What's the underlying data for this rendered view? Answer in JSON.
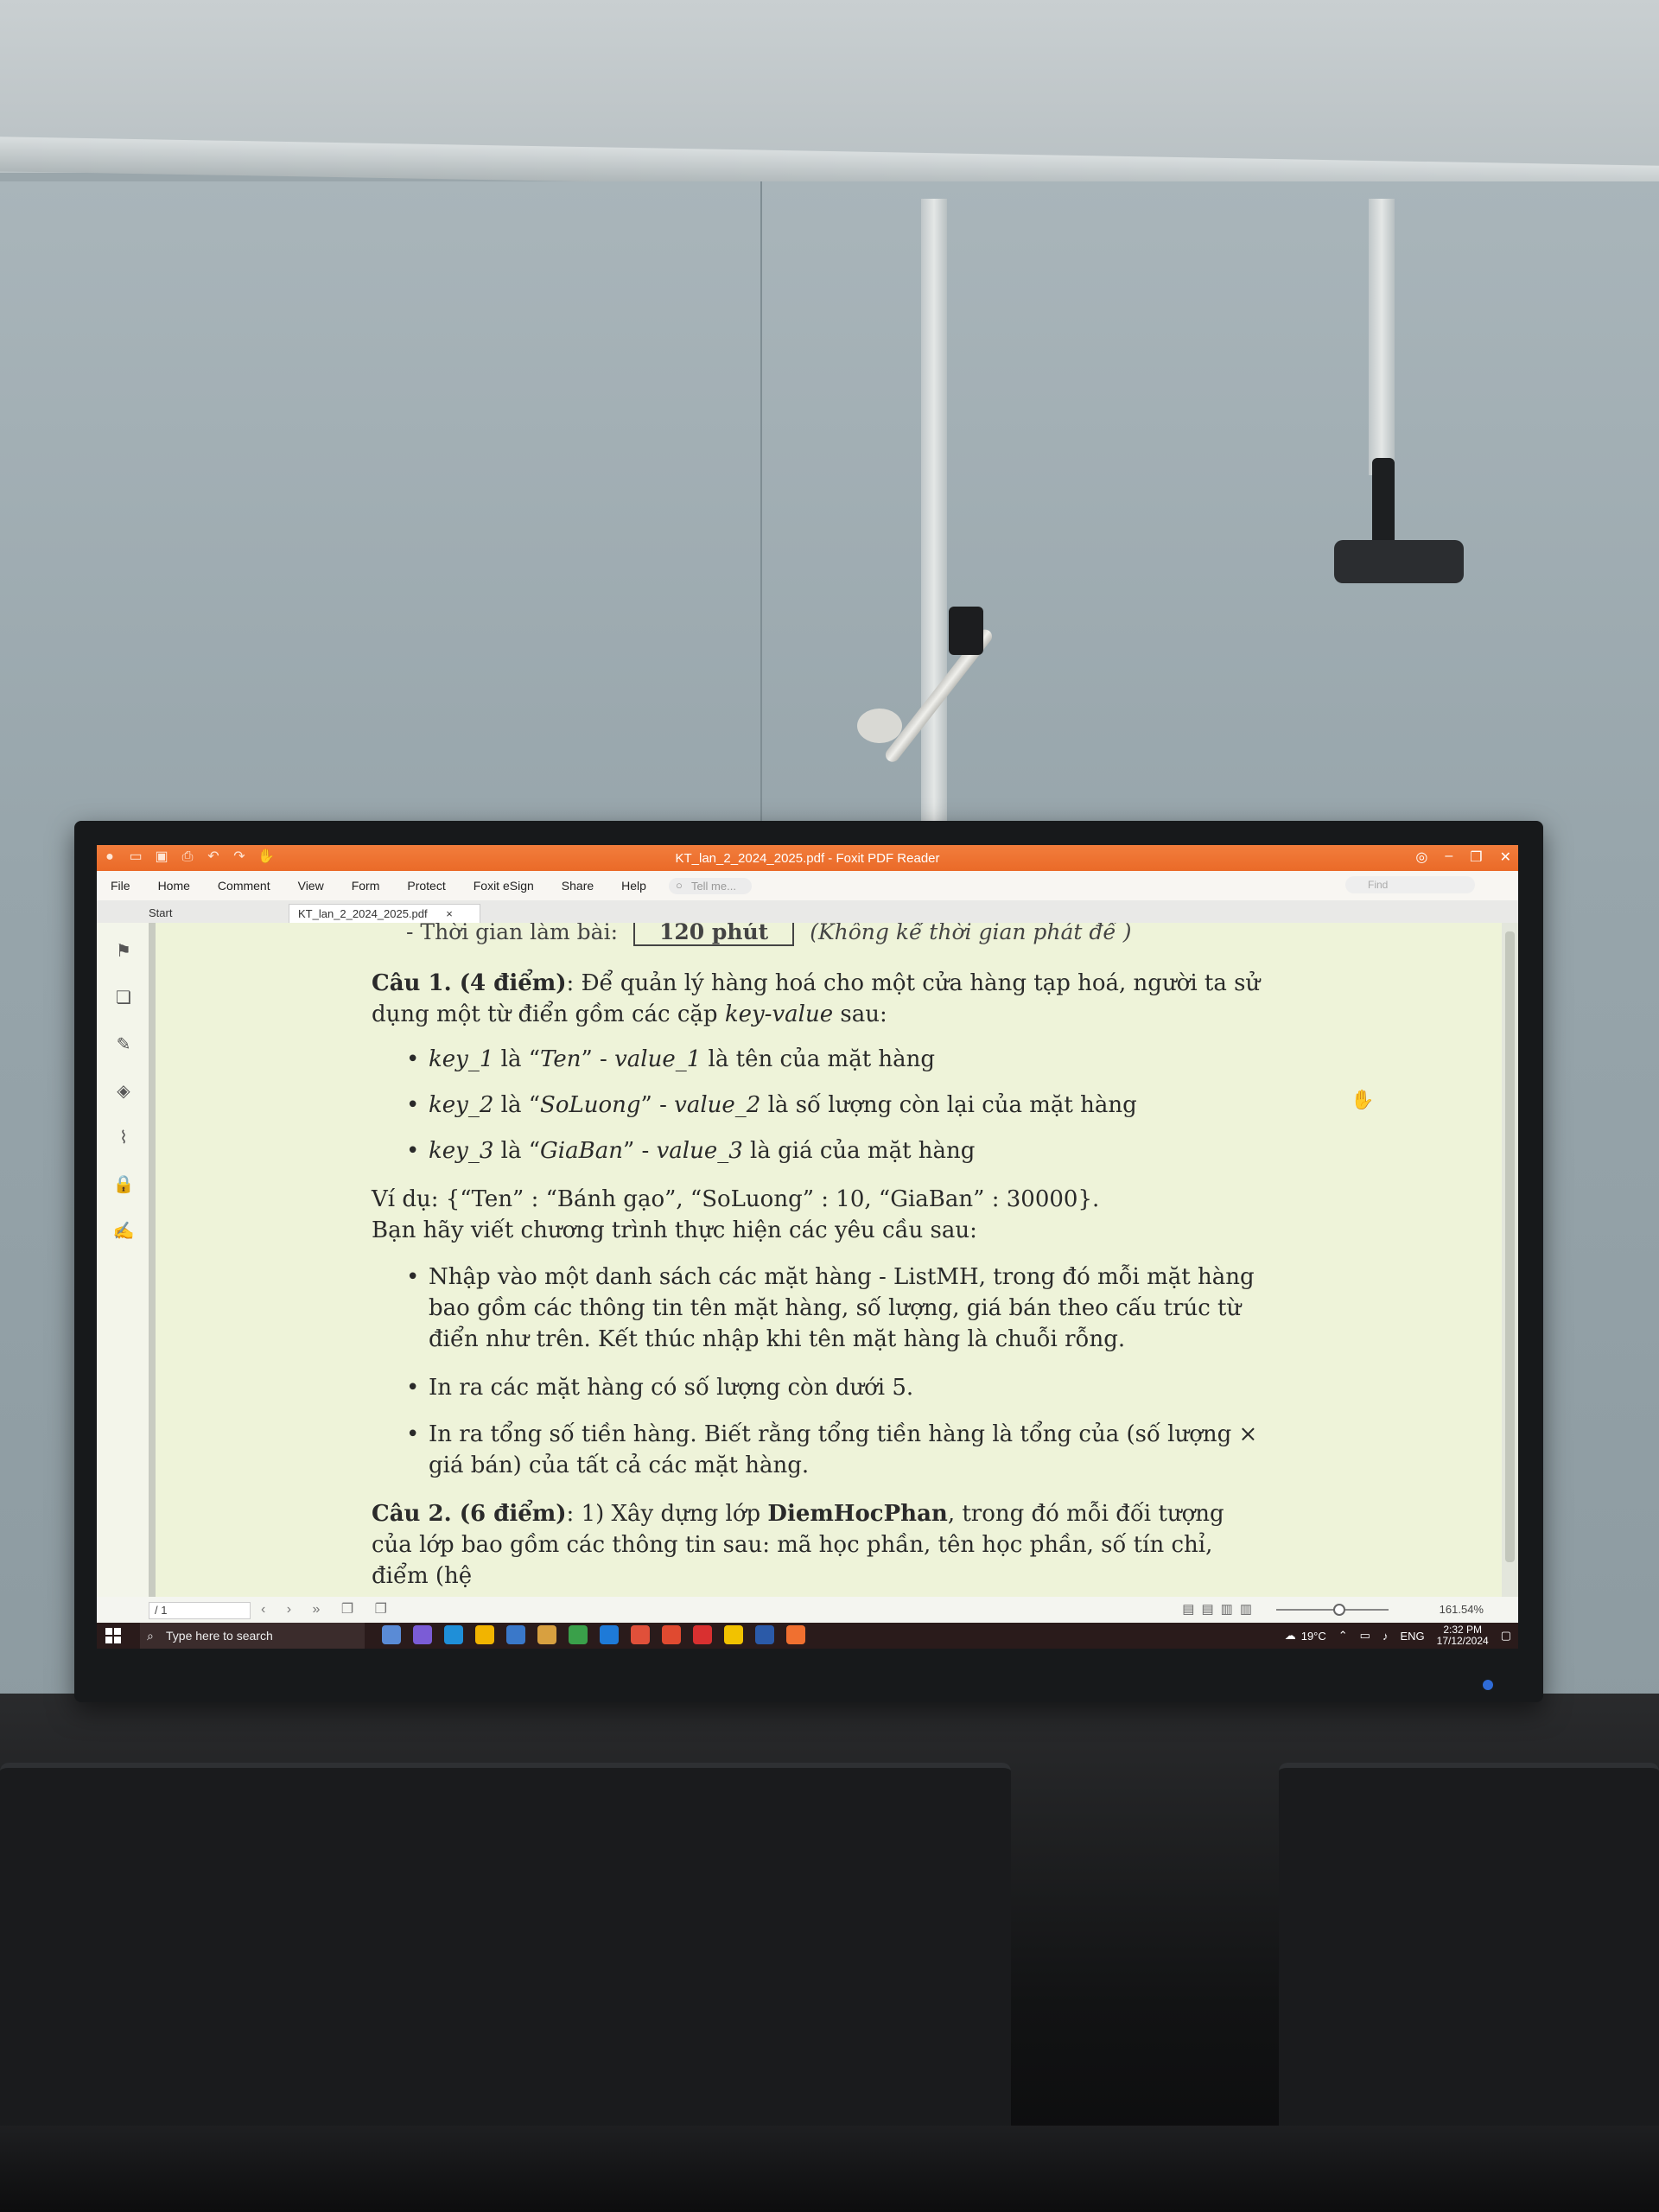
{
  "window": {
    "title": "KT_lan_2_2024_2025.pdf - Foxit PDF Reader"
  },
  "menu": {
    "items": [
      "File",
      "Home",
      "Comment",
      "View",
      "Form",
      "Protect",
      "Foxit eSign",
      "Share",
      "Help"
    ],
    "tell_me": "Tell me...",
    "find": "Find"
  },
  "tabs": [
    {
      "label": "Start"
    },
    {
      "label": "KT_lan_2_2024_2025.pdf",
      "close": "×"
    }
  ],
  "document": {
    "time_label": "- Thời gian làm bài:",
    "time_value": "120 phút",
    "time_note": "(Không kể thời gian phát đề )",
    "q1_head": "Câu 1. (4 điểm)",
    "q1_text": ": Để quản lý hàng hoá cho một cửa hàng tạp hoá, người ta sử dụng một từ điển gồm các cặp",
    "q1_kv": "key-value",
    "q1_tail": "sau:",
    "bullets_kv": [
      {
        "key": "key_1",
        "mid": "là “",
        "name": "Ten",
        "dash": "” - ",
        "val": "value_1",
        "desc": "là tên của mặt hàng"
      },
      {
        "key": "key_2",
        "mid": "là “",
        "name": "SoLuong",
        "dash": "” - ",
        "val": "value_2",
        "desc": "là số lượng còn lại của mặt hàng"
      },
      {
        "key": "key_3",
        "mid": "là “",
        "name": "GiaBan",
        "dash": "” - ",
        "val": "value_3",
        "desc": "là giá của mặt hàng"
      }
    ],
    "example": "Ví dụ: {“Ten” : “Bánh gạo”, “SoLuong” : 10, “GiaBan” : 30000}.",
    "request": "Bạn hãy viết chương trình thực hiện các yêu cầu sau:",
    "tasks": [
      "Nhập vào một danh sách các mặt hàng - ListMH, trong đó mỗi mặt hàng bao gồm các thông tin tên mặt hàng, số lượng, giá bán theo cấu trúc từ điển như trên. Kết thúc nhập khi tên mặt hàng là chuỗi rỗng.",
      "In ra các mặt hàng có số lượng còn dưới 5.",
      "In ra tổng số tiền hàng. Biết rằng tổng tiền hàng là tổng của (số lượng × giá bán) của tất cả các mặt hàng."
    ],
    "q2_head": "Câu 2. (6 điểm)",
    "q2_text": ": 1) Xây dựng lớp",
    "q2_class": "DiemHocPhan",
    "q2_tail": ", trong đó mỗi đối tượng của lớp bao gồm các thông tin sau: mã học phần, tên học phần, số tín chỉ, điểm (hệ"
  },
  "statusbar": {
    "page": "/ 1",
    "zoom": "161.54%"
  },
  "taskbar": {
    "search_placeholder": "Type here to search",
    "weather": "19°C",
    "lang": "ENG",
    "time": "2:32 PM",
    "date": "17/12/2024",
    "app_colors": [
      "#5a8bd6",
      "#7b5cd6",
      "#1f8fd8",
      "#f2b400",
      "#3a78c9",
      "#d8a040",
      "#3aa04a",
      "#1e7ad8",
      "#e0503a",
      "#e04a30",
      "#d93030",
      "#f2c200",
      "#2b5aa8",
      "#f07030"
    ]
  }
}
